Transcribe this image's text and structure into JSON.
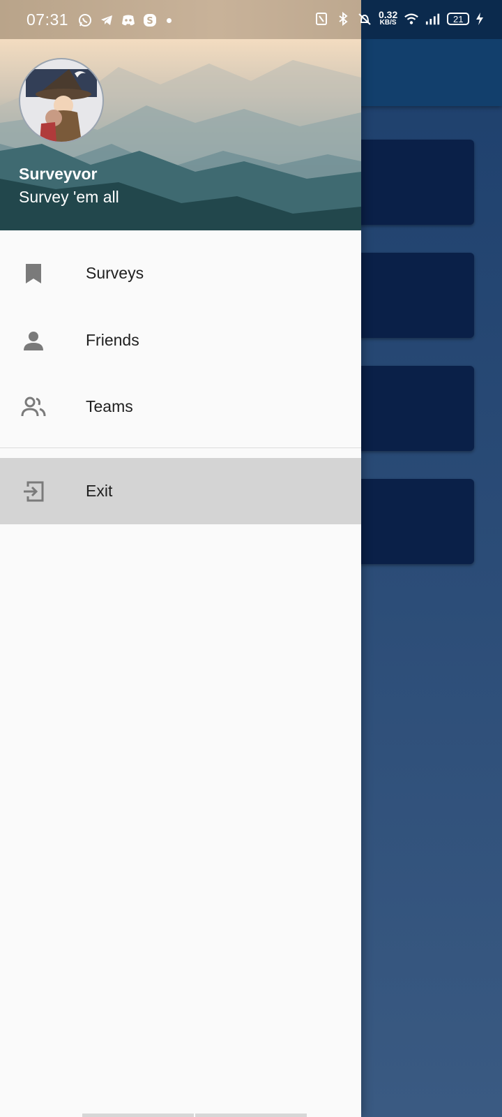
{
  "status_bar": {
    "time": "07:31",
    "notification_icons": [
      "whatsapp-icon",
      "telegram-icon",
      "discord-icon",
      "skype-icon"
    ],
    "net_speed_value": "0.32",
    "net_speed_unit": "KB/S",
    "battery_level": "21"
  },
  "drawer": {
    "header": {
      "user_name": "Surveyvor",
      "tagline": "Survey 'em all"
    },
    "menu": [
      {
        "label": "Surveys",
        "icon": "bookmark-icon"
      },
      {
        "label": "Friends",
        "icon": "person-icon"
      },
      {
        "label": "Teams",
        "icon": "people-icon"
      }
    ],
    "exit": {
      "label": "Exit",
      "icon": "exit-icon"
    }
  },
  "colors": {
    "drawer_bg": "#fafafa",
    "exit_bg": "#d4d4d4",
    "app_bar": "#123f6c",
    "card": "#0a2048",
    "icon_grey": "#7a7a7a"
  }
}
